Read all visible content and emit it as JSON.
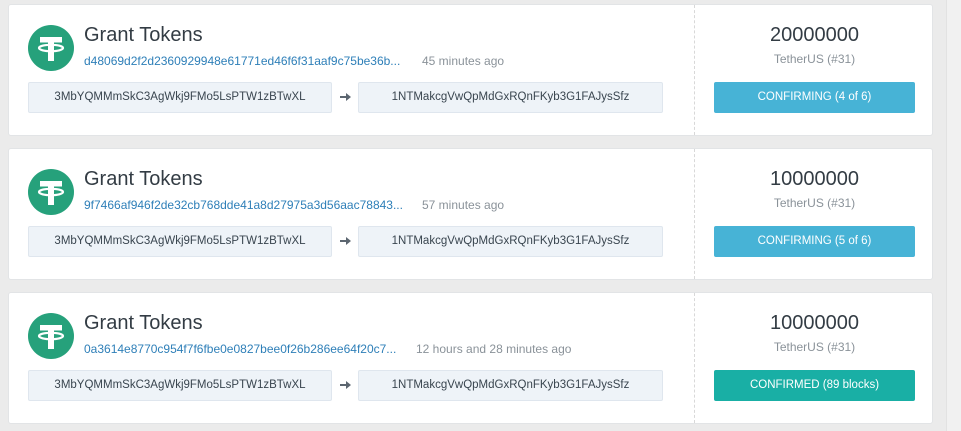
{
  "colors": {
    "confirming": "#47b3d6",
    "confirmed": "#19afa5",
    "tether_green": "#26a17b",
    "hash_link": "#2e7fb8"
  },
  "icons": {
    "token_logo": "tether-logo-icon",
    "transfer_arrow": "arrow-right-icon"
  },
  "transactions": [
    {
      "title": "Grant Tokens",
      "txid": "d48069d2f2d2360929948e61771ed46f6f31aaf9c75be36b...",
      "time": "45 minutes ago",
      "from": "3MbYQMMmSkC3AgWkj9FMo5LsPTW1zBTwXL",
      "to": "1NTMakcgVwQpMdGxRQnFKyb3G1FAJysSfz",
      "amount": "20000000",
      "token": "TetherUS (#31)",
      "status": "CONFIRMING (4 of 6)",
      "state": "confirming"
    },
    {
      "title": "Grant Tokens",
      "txid": "9f7466af946f2de32cb768dde41a8d27975a3d56aac78843...",
      "time": "57 minutes ago",
      "from": "3MbYQMMmSkC3AgWkj9FMo5LsPTW1zBTwXL",
      "to": "1NTMakcgVwQpMdGxRQnFKyb3G1FAJysSfz",
      "amount": "10000000",
      "token": "TetherUS (#31)",
      "status": "CONFIRMING (5 of 6)",
      "state": "confirming"
    },
    {
      "title": "Grant Tokens",
      "txid": "0a3614e8770c954f7f6fbe0e0827bee0f26b286ee64f20c7...",
      "time": "12 hours and 28 minutes ago",
      "from": "3MbYQMMmSkC3AgWkj9FMo5LsPTW1zBTwXL",
      "to": "1NTMakcgVwQpMdGxRQnFKyb3G1FAJysSfz",
      "amount": "10000000",
      "token": "TetherUS (#31)",
      "status": "CONFIRMED (89 blocks)",
      "state": "confirmed"
    }
  ]
}
